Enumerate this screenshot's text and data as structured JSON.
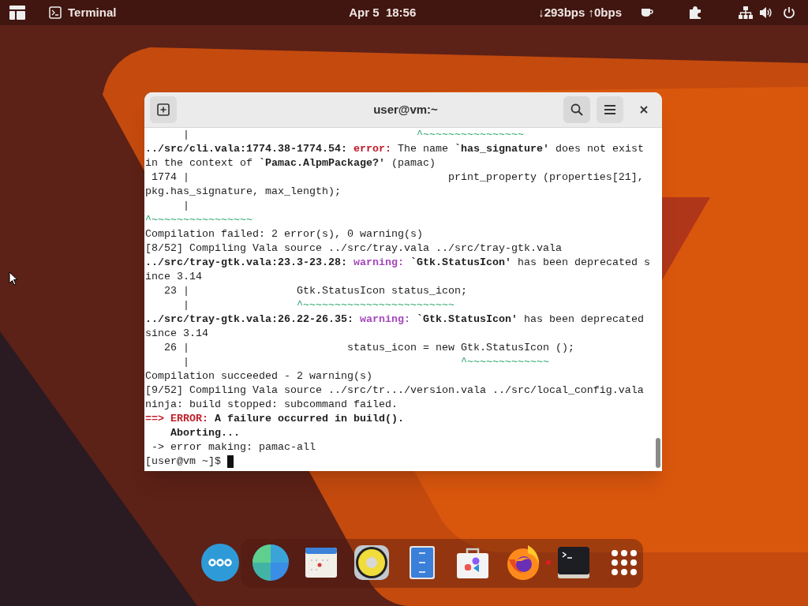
{
  "top_bar": {
    "app_name": "Terminal",
    "clock": "Apr 5  18:56",
    "network_speed": "↓293bps ↑0bps"
  },
  "terminal": {
    "title": "user@vm:~",
    "lines": [
      [
        {
          "kind": "plain",
          "text": "      |                                    "
        },
        {
          "kind": "caret",
          "text": "^~~~~~~~~~~~~~~~~"
        }
      ],
      [
        {
          "kind": "bold",
          "text": "../src/cli.vala:1774.38-1774.54: "
        },
        {
          "kind": "error",
          "text": "error:"
        },
        {
          "kind": "plain",
          "text": " The name "
        },
        {
          "kind": "bold",
          "text": "`has_signature'"
        },
        {
          "kind": "plain",
          "text": " does not exist"
        }
      ],
      [
        {
          "kind": "plain",
          "text": "in the context of "
        },
        {
          "kind": "bold",
          "text": "`Pamac.AlpmPackage?'"
        },
        {
          "kind": "plain",
          "text": " (pamac)"
        }
      ],
      [
        {
          "kind": "plain",
          "text": " 1774 |                                         print_property (properties[21],"
        }
      ],
      [
        {
          "kind": "plain",
          "text": "pkg.has_signature, max_length);"
        }
      ],
      [
        {
          "kind": "plain",
          "text": "      |"
        }
      ],
      [
        {
          "kind": "caret",
          "text": "^~~~~~~~~~~~~~~~~"
        }
      ],
      [
        {
          "kind": "plain",
          "text": "Compilation failed: 2 error(s), 0 warning(s)"
        }
      ],
      [
        {
          "kind": "plain",
          "text": "[8/52] Compiling Vala source ../src/tray.vala ../src/tray-gtk.vala"
        }
      ],
      [
        {
          "kind": "bold",
          "text": "../src/tray-gtk.vala:23.3-23.28: "
        },
        {
          "kind": "warning",
          "text": "warning:"
        },
        {
          "kind": "bold",
          "text": " `Gtk.StatusIcon'"
        },
        {
          "kind": "plain",
          "text": " has been deprecated s"
        }
      ],
      [
        {
          "kind": "plain",
          "text": "ince 3.14"
        }
      ],
      [
        {
          "kind": "plain",
          "text": "   23 |                 Gtk.StatusIcon status_icon;"
        }
      ],
      [
        {
          "kind": "plain",
          "text": "      |                 "
        },
        {
          "kind": "caret",
          "text": "^~~~~~~~~~~~~~~~~~~~~~~~~"
        }
      ],
      [
        {
          "kind": "bold",
          "text": "../src/tray-gtk.vala:26.22-26.35: "
        },
        {
          "kind": "warning",
          "text": "warning:"
        },
        {
          "kind": "bold",
          "text": " `Gtk.StatusIcon'"
        },
        {
          "kind": "plain",
          "text": " has been deprecated"
        }
      ],
      [
        {
          "kind": "plain",
          "text": "since 3.14"
        }
      ],
      [
        {
          "kind": "plain",
          "text": "   26 |                         status_icon = new Gtk.StatusIcon ();"
        }
      ],
      [
        {
          "kind": "plain",
          "text": "      |                                           "
        },
        {
          "kind": "caret",
          "text": "^~~~~~~~~~~~~~"
        }
      ],
      [
        {
          "kind": "plain",
          "text": "Compilation succeeded - 2 warning(s)"
        }
      ],
      [
        {
          "kind": "plain",
          "text": "[9/52] Compiling Vala source ../src/tr.../version.vala ../src/local_config.vala"
        }
      ],
      [
        {
          "kind": "plain",
          "text": "ninja: build stopped: subcommand failed."
        }
      ],
      [
        {
          "kind": "error",
          "text": "==> ERROR:"
        },
        {
          "kind": "bold",
          "text": " A failure occurred in build()."
        }
      ],
      [
        {
          "kind": "bold",
          "text": "    Aborting..."
        }
      ],
      [
        {
          "kind": "plain",
          "text": " -> error making: pamac-all"
        }
      ],
      [
        {
          "kind": "plain",
          "text": "[user@vm ~]$ "
        }
      ]
    ]
  },
  "dock": {
    "items": [
      {
        "kind": "more",
        "running": false
      },
      {
        "kind": "globe",
        "running": false
      },
      {
        "kind": "calendar",
        "running": false
      },
      {
        "kind": "speaker",
        "running": false
      },
      {
        "kind": "cabinet",
        "running": false
      },
      {
        "kind": "store",
        "running": false
      },
      {
        "kind": "browser",
        "running": false
      },
      {
        "kind": "terminal",
        "running": true
      },
      {
        "kind": "grid",
        "running": false
      }
    ]
  }
}
